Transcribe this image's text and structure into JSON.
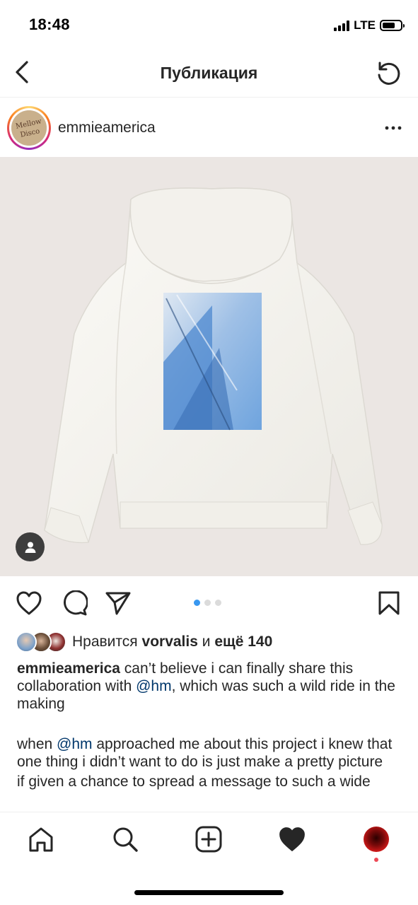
{
  "status_bar": {
    "time": "18:48",
    "network": "LTE",
    "icons": [
      "signal-icon",
      "battery-icon"
    ]
  },
  "nav": {
    "title": "Публикация",
    "icons": [
      "back-chevron-icon",
      "refresh-icon"
    ]
  },
  "post": {
    "username": "emmieamerica",
    "avatar_text": "Mellow Disco",
    "icons": [
      "more-icon",
      "user-tag-icon"
    ],
    "media": {
      "description_icon": "hoodie-image",
      "carousel_count": 3,
      "carousel_active_index": 0
    }
  },
  "actions": {
    "icons": [
      "heart-icon",
      "comment-icon",
      "share-icon",
      "bookmark-icon"
    ]
  },
  "likes": {
    "prefix": "Нравится",
    "user": "vorvalis",
    "middle": "и",
    "others": "ещё 140"
  },
  "caption": {
    "username": "emmieamerica",
    "line1_before": " can’t believe i can finally share this collaboration with ",
    "mention1": "@hm",
    "line1_after": ", which was such a wild ride in the making",
    "para2_before": "when ",
    "mention2": "@hm",
    "para2_after": " approached me about this project i knew that one thing i didn’t want to do is just make a pretty picture",
    "para3": "if given a chance to spread a message to such a wide"
  },
  "tab_bar": {
    "icons": [
      "home-icon",
      "search-icon",
      "new-post-icon",
      "activity-heart-icon",
      "profile-avatar"
    ]
  },
  "colors": {
    "accent_blue": "#3897f0",
    "mention_blue": "#00376b",
    "notification_red": "#ed4956",
    "text": "#262626",
    "media_bg": "#ebe6e3"
  }
}
